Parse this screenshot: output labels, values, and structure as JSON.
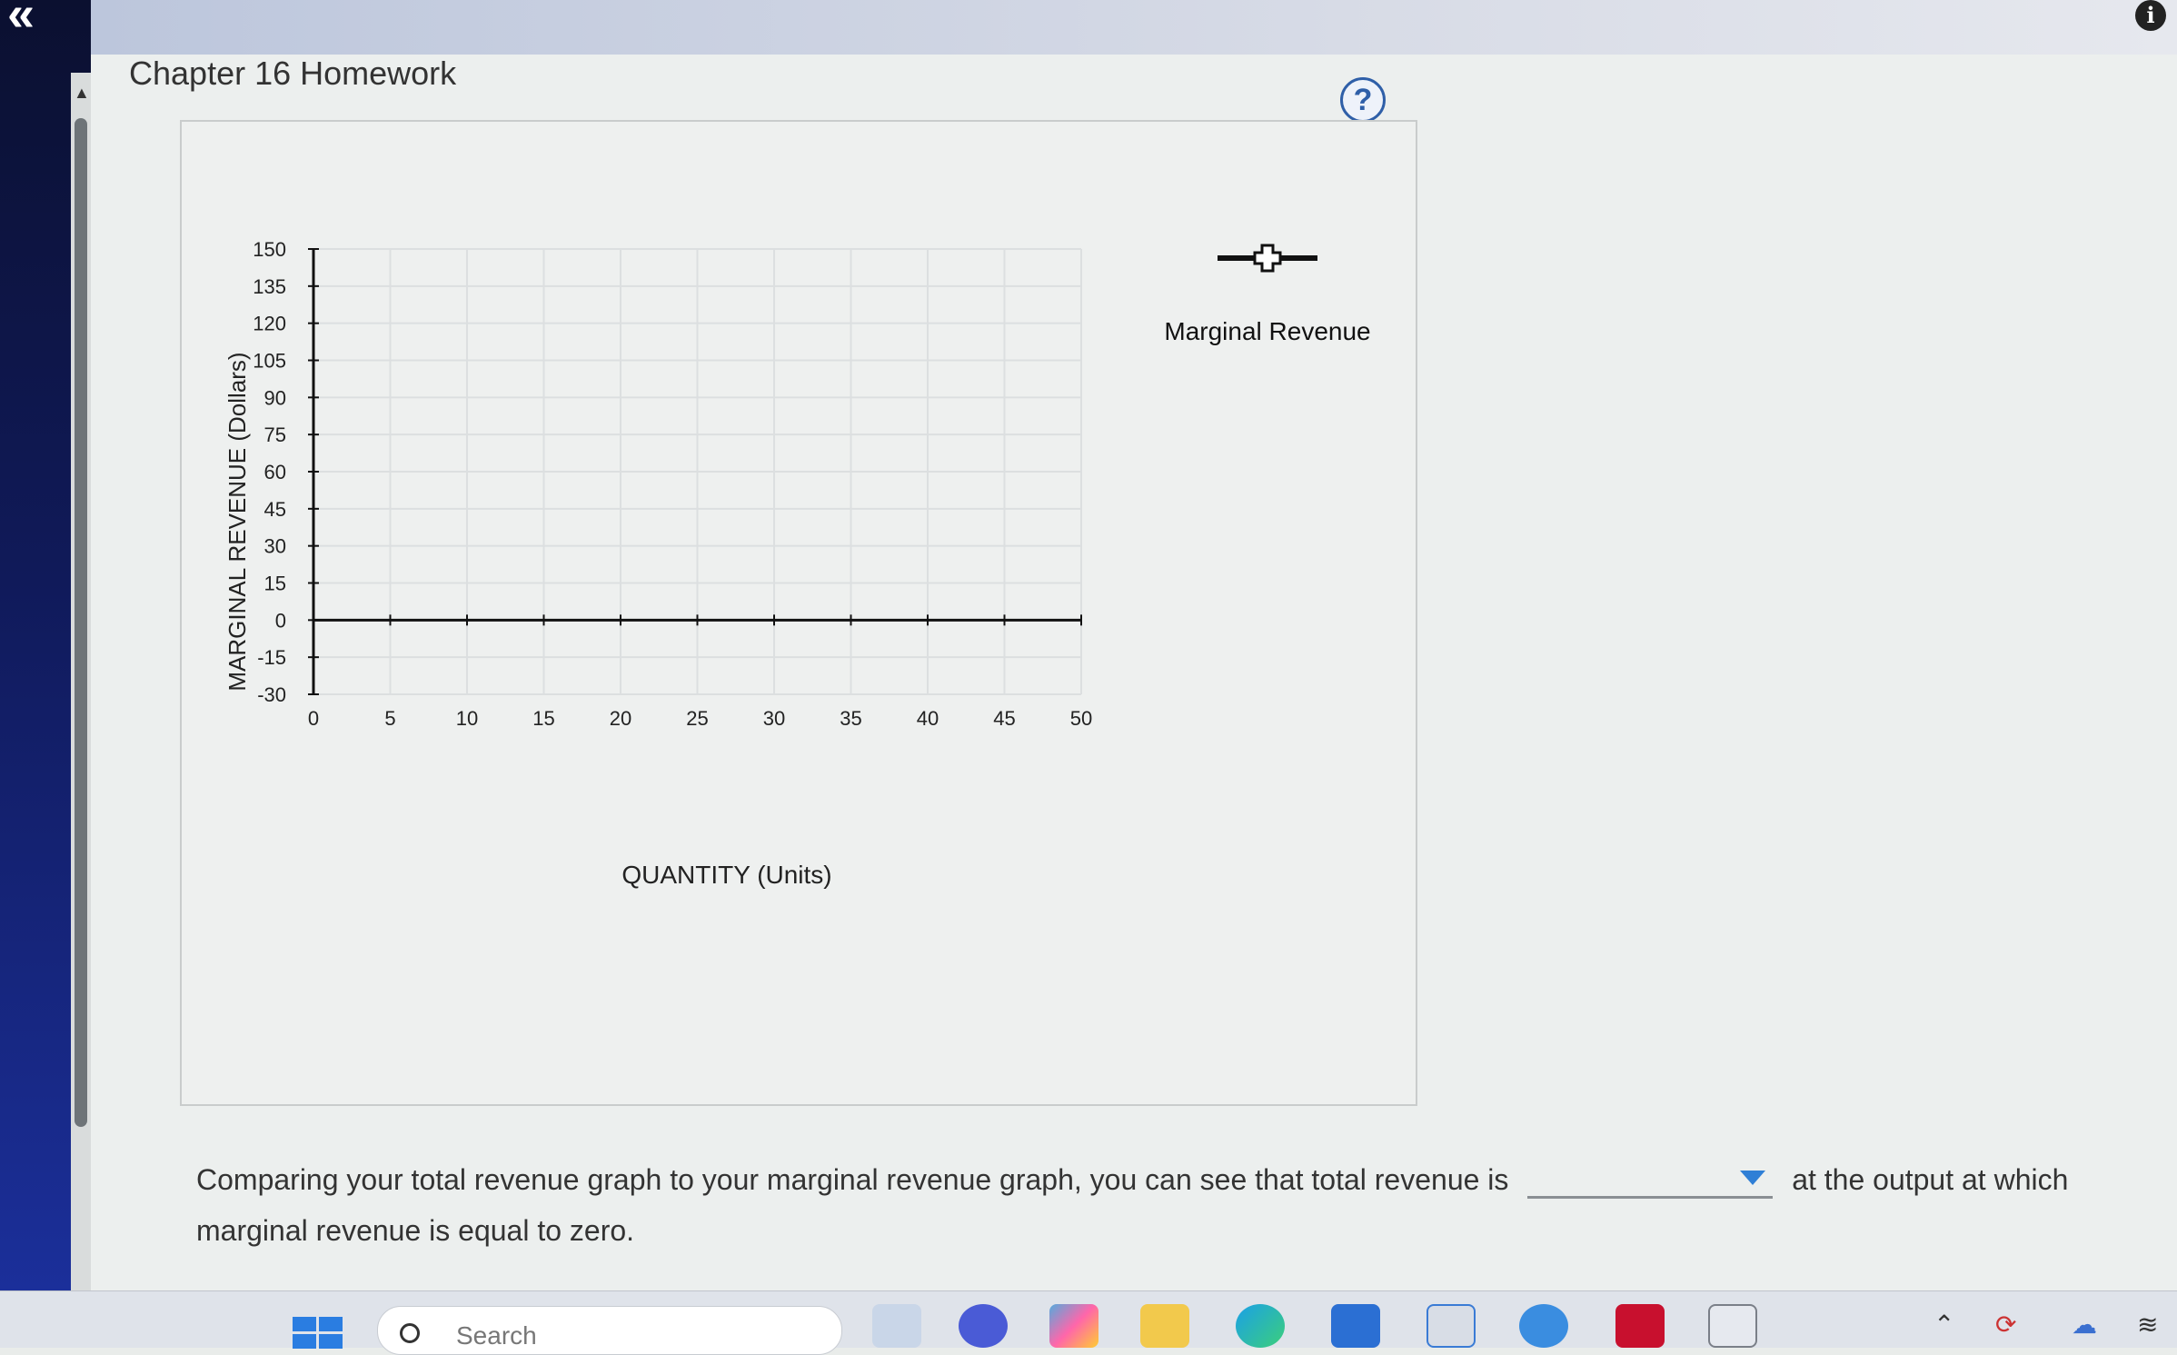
{
  "window": {
    "collapse_glyph": "«",
    "info_glyph": "i"
  },
  "assignment": {
    "title": "Chapter 16 Homework",
    "help_glyph": "?"
  },
  "chart_data": {
    "type": "line",
    "title": "",
    "xlabel": "QUANTITY (Units)",
    "ylabel": "MARGINAL REVENUE (Dollars)",
    "xlim": [
      0,
      50
    ],
    "ylim": [
      -30,
      150
    ],
    "x_ticks": [
      0,
      5,
      10,
      15,
      20,
      25,
      30,
      35,
      40,
      45,
      50
    ],
    "y_ticks": [
      150,
      135,
      120,
      105,
      90,
      75,
      60,
      45,
      30,
      15,
      0,
      -15,
      -30
    ],
    "grid": true,
    "series": [],
    "legend": [
      {
        "name": "Marginal Revenue",
        "marker": "plus",
        "color": "#111111",
        "placement": "right"
      }
    ]
  },
  "question": {
    "text_before": "Comparing your total revenue graph to your marginal revenue graph, you can see that total revenue is",
    "select_value": "",
    "text_after": "at the output at which marginal revenue is equal to zero."
  },
  "taskbar": {
    "search_placeholder": "Search",
    "icons": [
      "windows-start-icon",
      "file-explorer-icon",
      "video-call-icon",
      "copilot-icon",
      "folder-icon",
      "edge-icon",
      "mcafee-app-icon",
      "store-icon",
      "help-app-icon",
      "mcafee-shield-icon",
      "snipping-tool-icon"
    ],
    "colors": {
      "accent": "#2a7de1",
      "help_blue": "#2f5fa8",
      "axis": "#111111"
    }
  }
}
